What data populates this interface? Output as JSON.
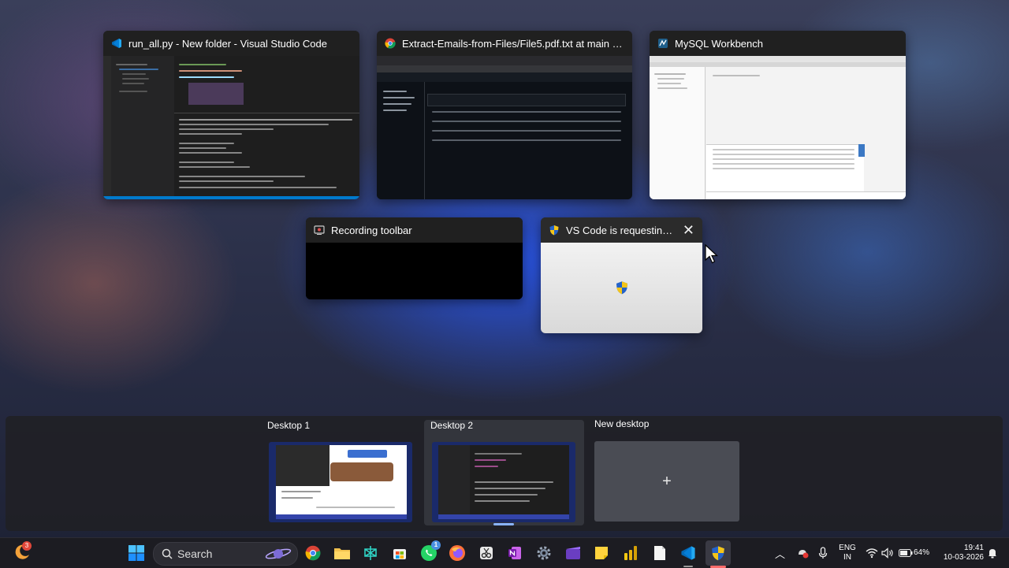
{
  "windows": [
    {
      "title": "run_all.py - New folder - Visual Studio Code",
      "icon": "vscode-icon"
    },
    {
      "title": "Extract-Emails-from-Files/File5.pdf.txt at main · shu...",
      "icon": "chrome-icon"
    },
    {
      "title": "MySQL Workbench",
      "icon": "mysql-workbench-icon"
    },
    {
      "title": "Recording toolbar",
      "icon": "recording-icon"
    },
    {
      "title": "VS Code is requesting...",
      "icon": "uac-shield-icon"
    }
  ],
  "desktops": {
    "items": [
      {
        "label": "Desktop 1"
      },
      {
        "label": "Desktop 2"
      }
    ],
    "new_label": "New desktop",
    "new_symbol": "+"
  },
  "taskbar": {
    "weather_badge": "3",
    "search_placeholder": "Search",
    "whatsapp_badge": "1",
    "language_line1": "ENG",
    "language_line2": "IN",
    "battery": "64%",
    "time": "19:41",
    "date": "10-03-2026"
  },
  "colors": {
    "accent": "#3b82f6",
    "vscode_blue": "#0078d4",
    "onenote_purple": "#7719aa"
  }
}
